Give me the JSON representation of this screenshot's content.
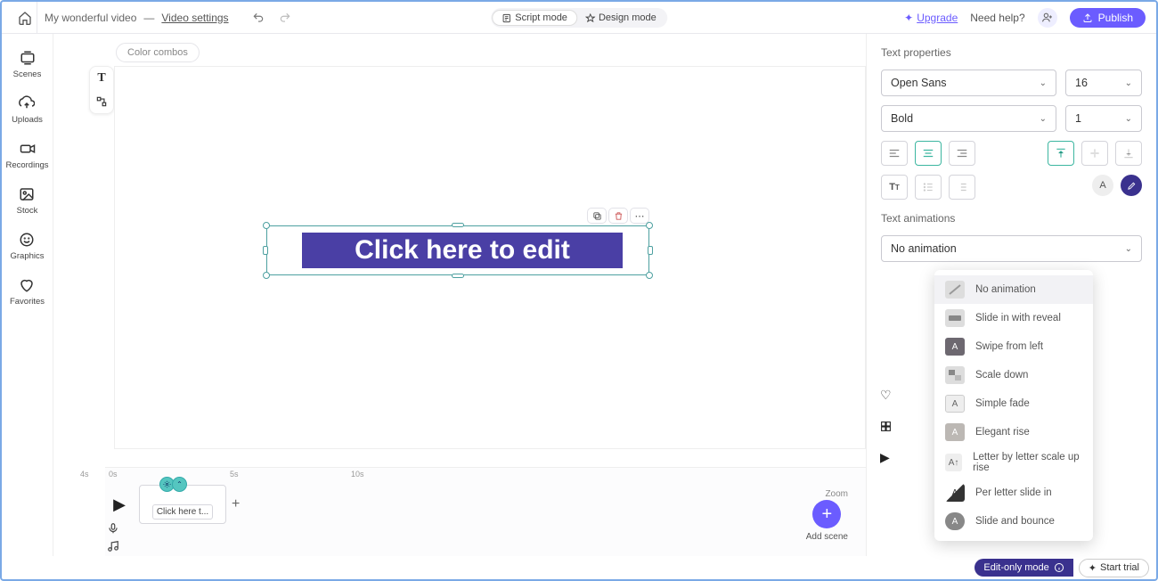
{
  "header": {
    "project_name": "My wonderful video",
    "separator": "—",
    "settings_link": "Video settings",
    "modes": {
      "script": "Script mode",
      "design": "Design mode"
    },
    "upgrade": "Upgrade",
    "upgrade_prefix": "+",
    "need_help": "Need help?",
    "publish": "Publish"
  },
  "left_rail": {
    "scenes": "Scenes",
    "uploads": "Uploads",
    "recordings": "Recordings",
    "stock": "Stock",
    "graphics": "Graphics",
    "favorites": "Favorites"
  },
  "canvas": {
    "color_combos": "Color combos",
    "text_content": "Click here to edit"
  },
  "right": {
    "text_props_title": "Text properties",
    "font_family": "Open Sans",
    "font_size": "16",
    "font_weight": "Bold",
    "line_height": "1",
    "text_anim_title": "Text animations",
    "anim_selected": "No animation",
    "anim_options": [
      "No animation",
      "Slide in with reveal",
      "Swipe from left",
      "Scale down",
      "Simple fade",
      "Elegant rise",
      "Letter by letter scale up rise",
      "Per letter slide in",
      "Slide and bounce"
    ]
  },
  "timeline": {
    "t0": "4s",
    "marks": {
      "m0": "0s",
      "m5": "5s",
      "m10": "10s"
    },
    "clip_label": "Click here t...",
    "zoom": "Zoom",
    "add_scene": "Add scene"
  },
  "footer": {
    "edit_only": "Edit-only mode",
    "start_trial": "Start trial"
  }
}
